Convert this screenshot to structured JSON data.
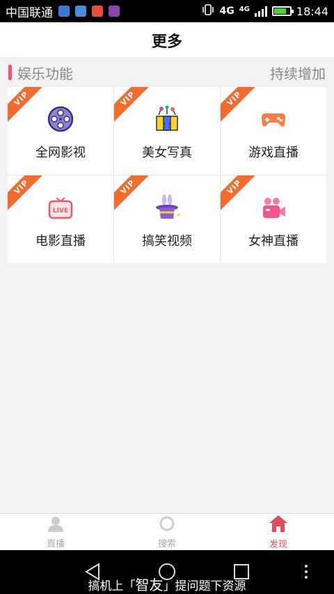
{
  "status_bar": {
    "carrier": "中国联通",
    "network": "4G",
    "network_small": "4G",
    "time": "18:44",
    "app_icon_colors": [
      "#3a7bd5",
      "#4a90d9",
      "#e74c3c",
      "#8e44ad"
    ]
  },
  "header": {
    "title": "更多"
  },
  "section": {
    "title": "娱乐功能",
    "more": "持续增加"
  },
  "grid_items": [
    {
      "label": "全网影视",
      "badge": "VIP",
      "icon": "film-reel-icon"
    },
    {
      "label": "美女写真",
      "badge": "VIP",
      "icon": "gift-box-icon"
    },
    {
      "label": "游戏直播",
      "badge": "VIP",
      "icon": "gamepad-icon"
    },
    {
      "label": "电影直播",
      "badge": "VIP",
      "icon": "live-tv-icon"
    },
    {
      "label": "搞笑视频",
      "badge": "VIP",
      "icon": "magic-hat-icon"
    },
    {
      "label": "女神直播",
      "badge": "VIP",
      "icon": "video-camera-icon"
    }
  ],
  "bottom_nav": [
    {
      "label": "直播",
      "icon": "person-icon",
      "active": false
    },
    {
      "label": "搜索",
      "icon": "circle-icon",
      "active": false
    },
    {
      "label": "发现",
      "icon": "home-icon",
      "active": true
    }
  ],
  "watermark": {
    "prefix": "搞机上「",
    "brand": "智友",
    "suffix": "」提问题下资源"
  },
  "colors": {
    "accent": "#e04a5e",
    "vip": "#f46b2d",
    "section_bar": "#ff4d6d"
  }
}
